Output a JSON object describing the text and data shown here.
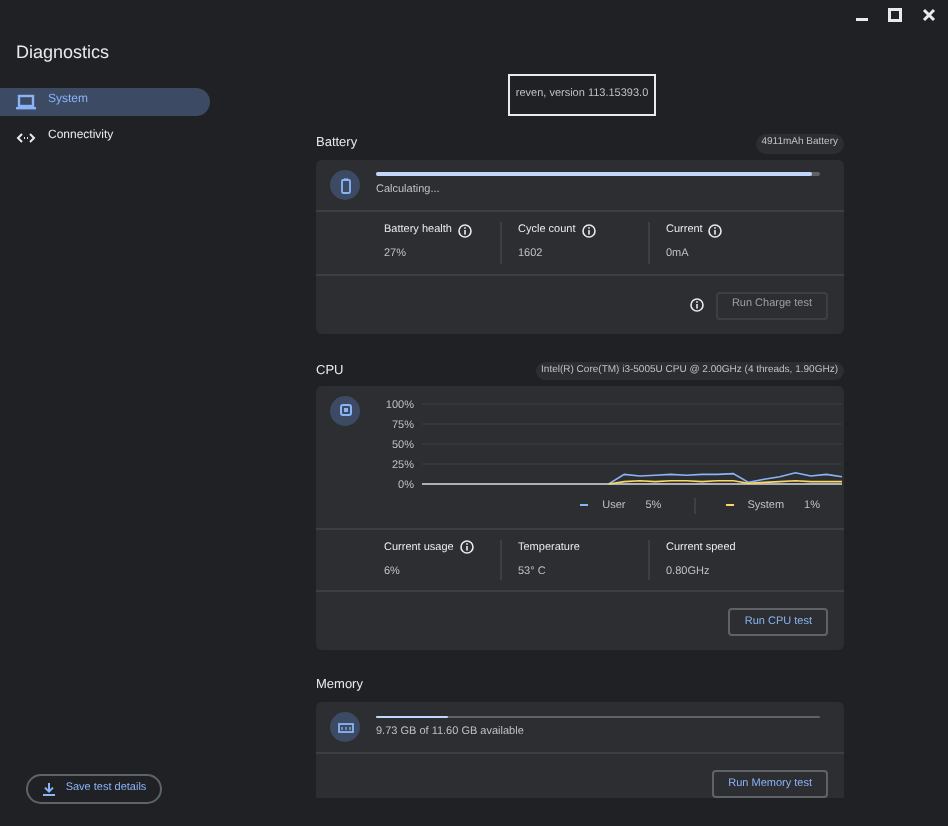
{
  "window": {
    "title": "Diagnostics"
  },
  "sidebar": {
    "items": [
      {
        "label": "System",
        "selected": true
      },
      {
        "label": "Connectivity",
        "selected": false
      }
    ],
    "save_button": "Save test details"
  },
  "version": "reven, version 113.15393.0",
  "battery": {
    "title": "Battery",
    "badge": "4911mAh Battery",
    "status": "Calculating...",
    "level": 0.98,
    "stats": [
      {
        "label": "Battery health",
        "value": "27%",
        "info": true
      },
      {
        "label": "Cycle count",
        "value": "1602",
        "info": true
      },
      {
        "label": "Current",
        "value": "0mA",
        "info": true
      }
    ],
    "button": "Run Charge test",
    "button_disabled": true
  },
  "cpu": {
    "title": "CPU",
    "badge": "Intel(R) Core(TM) i3-5005U CPU @ 2.00GHz (4 threads, 1.90GHz)",
    "chart_data": {
      "type": "line",
      "grid": true,
      "ylim": [
        0,
        100
      ],
      "yticks": [
        {
          "value": 0,
          "label": "0%"
        },
        {
          "value": 25,
          "label": "25%"
        },
        {
          "value": 50,
          "label": "50%"
        },
        {
          "value": 75,
          "label": "75%"
        },
        {
          "value": 100,
          "label": "100%"
        }
      ],
      "series": [
        {
          "name": "User",
          "color": "#8ab4f8",
          "values": [
            null,
            null,
            null,
            null,
            null,
            null,
            null,
            null,
            null,
            null,
            null,
            null,
            0,
            12,
            10,
            11,
            12,
            11,
            12,
            12,
            13,
            2,
            6,
            9,
            14,
            10,
            12,
            9
          ]
        },
        {
          "name": "System",
          "color": "#fdd663",
          "values": [
            null,
            null,
            null,
            null,
            null,
            null,
            null,
            null,
            null,
            null,
            null,
            null,
            0,
            3,
            4,
            3,
            4,
            4,
            3,
            4,
            4,
            1,
            2,
            3,
            4,
            3,
            3,
            3
          ]
        }
      ]
    },
    "legend": [
      {
        "value": "5%"
      },
      {
        "value": "1%"
      }
    ],
    "stats": [
      {
        "label": "Current usage",
        "value": "6%",
        "info": true
      },
      {
        "label": "Temperature",
        "value": "53° C",
        "info": false
      },
      {
        "label": "Current speed",
        "value": "0.80GHz",
        "info": false
      }
    ],
    "button": "Run CPU test",
    "button_disabled": false
  },
  "memory": {
    "title": "Memory",
    "status": "9.73 GB of 11.60 GB available",
    "level": 0.16,
    "button": "Run Memory test",
    "button_disabled": false
  }
}
